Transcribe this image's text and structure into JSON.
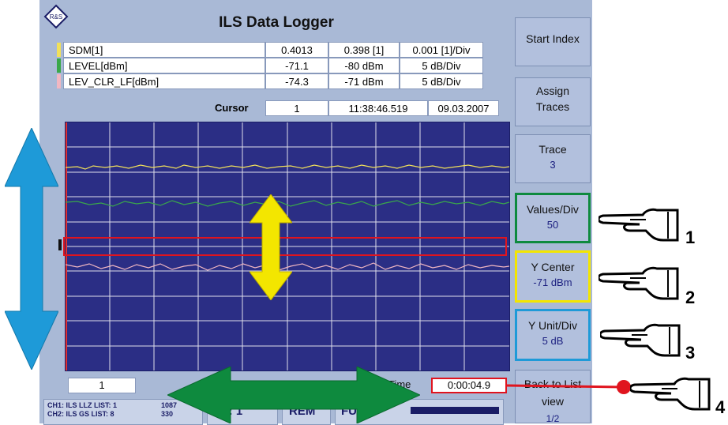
{
  "app": {
    "title": "ILS Data Logger"
  },
  "traces": [
    {
      "name": "SDM[1]",
      "value": "0.4013",
      "center": "0.398 [1]",
      "div": "0.001 [1]/Div",
      "color": "#f1e05a"
    },
    {
      "name": "LEVEL[dBm]",
      "value": "-71.1",
      "center": "-80 dBm",
      "div": "5 dB/Div",
      "color": "#3aa84a"
    },
    {
      "name": "LEV_CLR_LF[dBm]",
      "value": "-74.3",
      "center": "-71 dBm",
      "div": "5 dB/Div",
      "color": "#f1b7c2"
    }
  ],
  "cursor": {
    "label": "Cursor",
    "index": "1",
    "time": "11:38:46.519",
    "date": "09.03.2007"
  },
  "sidebar": {
    "start_index": "Start Index",
    "assign_traces": "Assign Traces",
    "trace": {
      "label": "Trace",
      "value": "3"
    },
    "values_div": {
      "label": "Values/Div",
      "value": "50"
    },
    "y_center": {
      "label": "Y Center",
      "value": "-71 dBm"
    },
    "y_unit_div": {
      "label": "Y Unit/Div",
      "value": "5 dB"
    },
    "back": {
      "label": "Back to List view",
      "page": "1/2"
    }
  },
  "bottom": {
    "index": "1",
    "time_label": "Time",
    "time_value": "0:00:04.9",
    "ch_line1": "CH1: ILS LLZ  LIST: 1",
    "ch_line1_count": "1087",
    "ch_line2": "CH2: ILS GS   LIST: 8",
    "ch_line2_count": "330",
    "channel": "CH: 1",
    "rem": "REM",
    "full": "FULL"
  },
  "callouts": [
    "1",
    "2",
    "3",
    "4"
  ],
  "colors": {
    "accent_green": "#0e8a3e",
    "accent_yellow": "#f3e600",
    "accent_blue": "#1e9ad8",
    "highlight_red": "#e0141e",
    "plot_bg": "#2b2e85"
  }
}
